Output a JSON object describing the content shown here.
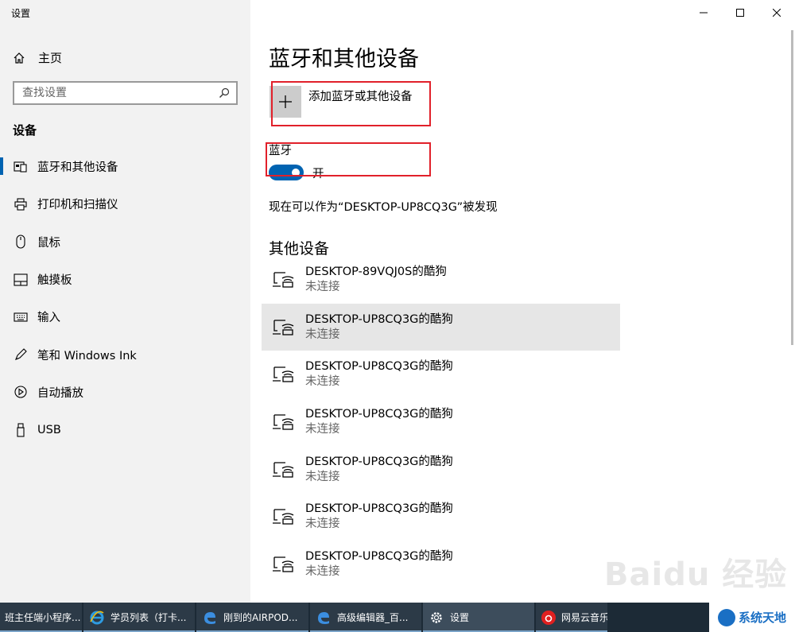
{
  "window": {
    "title": "设置"
  },
  "sidebar": {
    "home_label": "主页",
    "search_placeholder": "查找设置",
    "section_title": "设备",
    "items": [
      {
        "label": "蓝牙和其他设备",
        "icon": "bluetooth-devices-icon",
        "active": true
      },
      {
        "label": "打印机和扫描仪",
        "icon": "printer-icon"
      },
      {
        "label": "鼠标",
        "icon": "mouse-icon"
      },
      {
        "label": "触摸板",
        "icon": "touchpad-icon"
      },
      {
        "label": "输入",
        "icon": "keyboard-icon"
      },
      {
        "label": "笔和 Windows Ink",
        "icon": "pen-icon"
      },
      {
        "label": "自动播放",
        "icon": "autoplay-icon"
      },
      {
        "label": "USB",
        "icon": "usb-icon"
      }
    ]
  },
  "main": {
    "title": "蓝牙和其他设备",
    "add_device_label": "添加蓝牙或其他设备",
    "bluetooth_label": "蓝牙",
    "bluetooth_state": "开",
    "discoverable_text": "现在可以作为“DESKTOP-UP8CQ3G”被发现",
    "other_devices_title": "其他设备",
    "devices": [
      {
        "name": "DESKTOP-89VQJ0S的酷狗",
        "status": "未连接"
      },
      {
        "name": "DESKTOP-UP8CQ3G的酷狗",
        "status": "未连接"
      },
      {
        "name": "DESKTOP-UP8CQ3G的酷狗",
        "status": "未连接"
      },
      {
        "name": "DESKTOP-UP8CQ3G的酷狗",
        "status": "未连接"
      },
      {
        "name": "DESKTOP-UP8CQ3G的酷狗",
        "status": "未连接"
      },
      {
        "name": "DESKTOP-UP8CQ3G的酷狗",
        "status": "未连接"
      },
      {
        "name": "DESKTOP-UP8CQ3G的酷狗",
        "status": "未连接"
      }
    ]
  },
  "watermark": "Baidu 经验",
  "taskbar": {
    "items": [
      {
        "label": "班主任端小程序...",
        "icon": ""
      },
      {
        "label": "学员列表（打卡...",
        "icon": "ie-icon"
      },
      {
        "label": "刚到的AIRPOD...",
        "icon": "edge-icon"
      },
      {
        "label": "高级编辑器_百...",
        "icon": "edge-icon"
      },
      {
        "label": "设置",
        "icon": "gear-icon"
      },
      {
        "label": "网易云音乐",
        "icon": "netease-music-icon"
      }
    ],
    "brand": "系统天地"
  },
  "colors": {
    "accent": "#0063b1",
    "highlight_box": "#e1202a",
    "sidebar_bg": "#f2f2f2",
    "taskbar_bg": "#1c2a36"
  }
}
